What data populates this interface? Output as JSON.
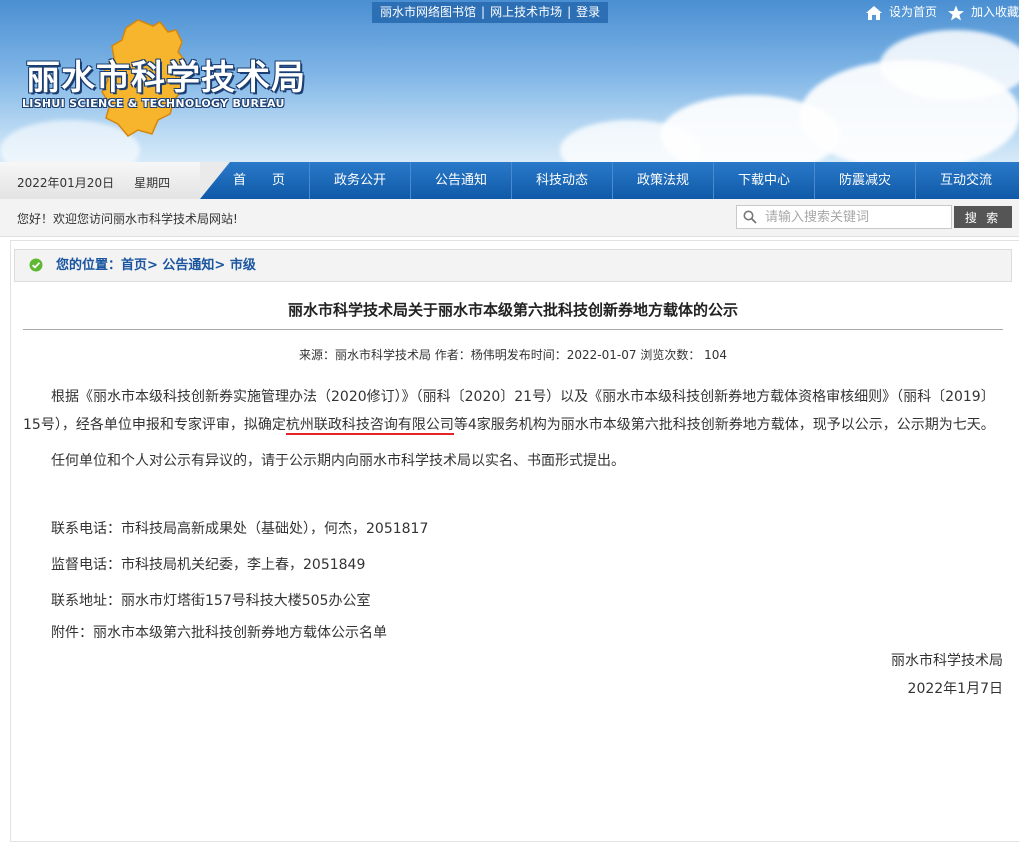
{
  "header": {
    "top_links": [
      "丽水市网络图书馆",
      "网上技术市场",
      "登录"
    ],
    "set_home": "设为首页",
    "add_favorite": "加入收藏",
    "logo_cn": "丽水市科学技术局",
    "logo_en": "LISHUI SCIENCE & TECHNOLOGY BUREAU"
  },
  "navbar": {
    "date": "2022年01月20日",
    "weekday": "星期四",
    "items": [
      "首　　页",
      "政务公开",
      "公告通知",
      "科技动态",
      "政策法规",
      "下载中心",
      "防震减灾",
      "互动交流"
    ]
  },
  "welcome": {
    "message": "您好！欢迎您访问丽水市科学技术局网站!",
    "search_placeholder": "请输入搜索关键词",
    "search_button": "搜 索"
  },
  "breadcrumb": "您的位置：首页> 公告通知> 市级",
  "article": {
    "title": "丽水市科学技术局关于丽水市本级第六批科技创新券地方载体的公示",
    "meta": "来源：丽水市科学技术局 作者：杨伟明发布时间：2022-01-07  浏览次数： 104",
    "para1_a": "根据《丽水市本级科技创新券实施管理办法（2020修订）》（丽科〔2020〕21号）以及《丽水市本级科技创新券地方载体资格审核细则》（丽科〔2019〕15号），经各单位申报和专家评审，拟确定",
    "para1_highlight": "杭州联政科技咨询有限公司",
    "para1_b": "等4家服务机构为丽水市本级第六批科技创新券地方载体，现予以公示，公示期为七天。",
    "para2": "任何单位和个人对公示有异议的，请于公示期内向丽水市科学技术局以实名、书面形式提出。",
    "contact_phone": "联系电话：市科技局高新成果处（基础处），何杰，2051817",
    "supervise_phone": "监督电话：市科技局机关纪委，李上春，2051849",
    "address": "联系地址：丽水市灯塔街157号科技大楼505办公室",
    "attachment": "附件：丽水市本级第六批科技创新券地方载体公示名单",
    "signature": "丽水市科学技术局",
    "date": "2022年1月7日"
  },
  "colors": {
    "nav_blue": "#0f5aa8",
    "highlight_underline": "#e3242b",
    "breadcrumb_text": "#1a55a0"
  }
}
